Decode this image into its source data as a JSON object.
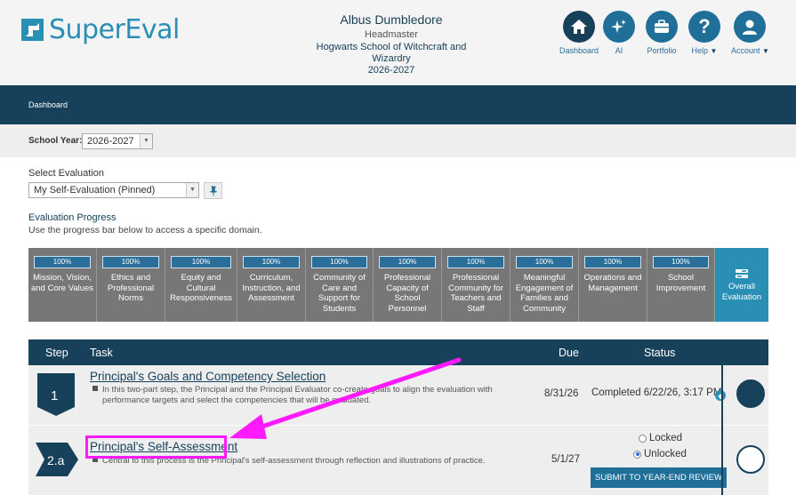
{
  "app": {
    "logo_text": "SuperEval"
  },
  "user": {
    "name": "Albus Dumbledore",
    "role": "Headmaster",
    "school": "Hogwarts School of Witchcraft and Wizardry",
    "year": "2026-2027"
  },
  "nav": {
    "dashboard": "Dashboard",
    "ai": "AI",
    "portfolio": "Portfolio",
    "help": "Help",
    "account": "Account"
  },
  "breadcrumb": "Dashboard",
  "school_year": {
    "label": "School Year:",
    "value": "2026-2027"
  },
  "select_evaluation": {
    "label": "Select Evaluation",
    "value": "My Self-Evaluation (Pinned)"
  },
  "progress": {
    "title": "Evaluation Progress",
    "subtitle": "Use the progress bar below to access a specific domain.",
    "domains": [
      {
        "pct": "100%",
        "name": "Mission, Vision, and Core Values"
      },
      {
        "pct": "100%",
        "name": "Ethics and Professional Norms"
      },
      {
        "pct": "100%",
        "name": "Equity and Cultural Responsiveness"
      },
      {
        "pct": "100%",
        "name": "Curriculum, Instruction, and Assessment"
      },
      {
        "pct": "100%",
        "name": "Community of Care and Support for Students"
      },
      {
        "pct": "100%",
        "name": "Professional Capacity of School Personnel"
      },
      {
        "pct": "100%",
        "name": "Professional Community for Teachers and Staff"
      },
      {
        "pct": "100%",
        "name": "Meaningful Engagement of Families and Community"
      },
      {
        "pct": "100%",
        "name": "Operations and Management"
      },
      {
        "pct": "100%",
        "name": "School Improvement"
      }
    ],
    "overall": "Overall Evaluation"
  },
  "table": {
    "headers": {
      "step": "Step",
      "task": "Task",
      "due": "Due",
      "status": "Status"
    },
    "rows": [
      {
        "step": "1",
        "title": "Principal's Goals and Competency Selection",
        "desc_line1": "In this two-part step, the Principal and the Principal Evaluator co-create goals to align the evaluation with",
        "desc_line2": "performance targets and select the competencies that will be evaluated.",
        "due": "8/31/26",
        "status": "Completed 6/22/26, 3:17 PM"
      },
      {
        "step": "2.a",
        "title": "Principal's Self-Assessment",
        "desc_line1": "Central to this process is the Principal's self-assessment through reflection and illustrations of practice.",
        "due": "5/1/27",
        "radio_locked": "Locked",
        "radio_unlocked": "Unlocked",
        "submit": "SUBMIT TO YEAR-END REVIEW"
      }
    ]
  },
  "colors": {
    "navy": "#17405a",
    "accent": "#2a8fb5",
    "highlight": "#ff1aff"
  }
}
